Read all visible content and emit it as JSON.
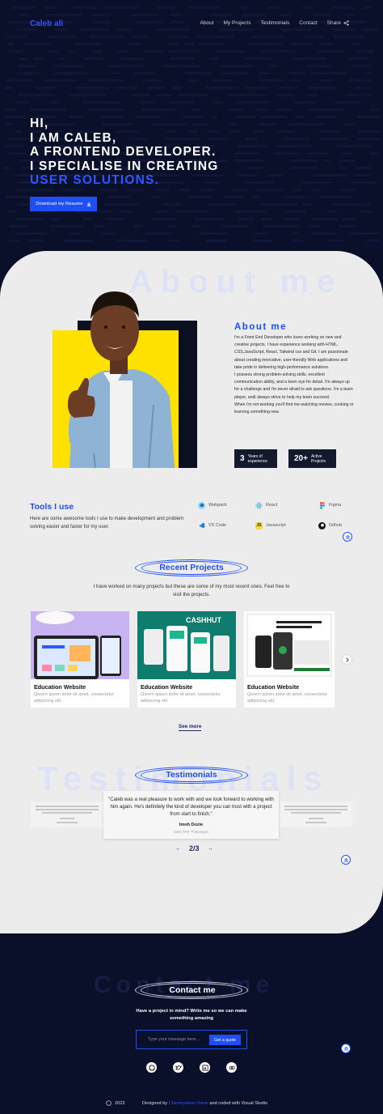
{
  "nav": {
    "logo": "Caleb ali",
    "links": [
      "About",
      "My Projects",
      "Testimonials",
      "Contact"
    ],
    "share": "Share"
  },
  "hero": {
    "line1": "HI,",
    "line2": "I AM CALEB,",
    "line3": "A FRONTEND DEVELOPER.",
    "line4": "I SPECIALISE IN CREATING",
    "line5": "USER SOLUTIONS.",
    "download_label": "Download my Resume"
  },
  "about": {
    "ghost": "About me",
    "heading": "About me",
    "paragraph1": "I'm a Front End Developer who loves working on new and creative projects. I have experience working with HTML, CSS,JavaScript, React, Tailwind css and Git. I am passionate about creating innovative, user-friendly Web applications and take pride in delivering high-performance solutions.",
    "paragraph2": "I possess strong problem-solving skills, excellent communication ability, and a keen eye for detail. I'm always up for a challenge and i'm never afraid to ask questions. I'm a team player, andi always strive to help my team succeed.",
    "paragraph3": "When i'm not working you'll find me watching movies, cooking or learning something new.",
    "stats": [
      {
        "number": "3",
        "label1": "Years of",
        "label2": "experience"
      },
      {
        "number": "20+",
        "label1": "Active",
        "label2": "Projects"
      }
    ]
  },
  "tools": {
    "heading": "Tools I use",
    "description": "Here are some awesome tools I use to make development and problem solving easier and faster for my user.",
    "items": [
      "Webpack",
      "React",
      "Figma",
      "VS Code",
      "Javascript",
      "Github"
    ]
  },
  "projects": {
    "title": "Recent Projects",
    "description": "I have worked on many projects but these are some of my most recent ones. Feel free to visit the projects.",
    "cards": [
      {
        "title": "Education Website",
        "desc": "Qorem ipsum dolor sit amet, consectetur adipiscing elit."
      },
      {
        "title": "Education Website",
        "desc": "Qorem ipsum dolor sit amet, consectetur adipiscing elit."
      },
      {
        "title": "Education Website",
        "desc": "Qorem ipsum dolor sit amet, consectetur adipiscing elit."
      }
    ],
    "see_more": "See more"
  },
  "testimonials": {
    "ghost": "Testimonials",
    "title": "Testimonials",
    "quote": "\"Caleb was a real pleasure to work with and we look forward to working with him again. He's definitely the kind of developer you can trust with a project from start to finish.\"",
    "name": "Imoh Dozie",
    "role": "CEO TAF, Thrivexpro",
    "page": "2/3"
  },
  "contact": {
    "ghost": "Contact me",
    "title": "Contact me",
    "description": "Have a project in mind? Write me so we can make something amazing",
    "placeholder": "Type your message here...",
    "button": "Get a quote"
  },
  "footer": {
    "year": "2023",
    "designed_prefix": "Designed by",
    "designer": "Chinonyelum chime",
    "suffix": "and coded with Visual Studio"
  },
  "colors": {
    "accent": "#1f4ef5",
    "dark": "#0a1029",
    "light": "#ececec"
  }
}
